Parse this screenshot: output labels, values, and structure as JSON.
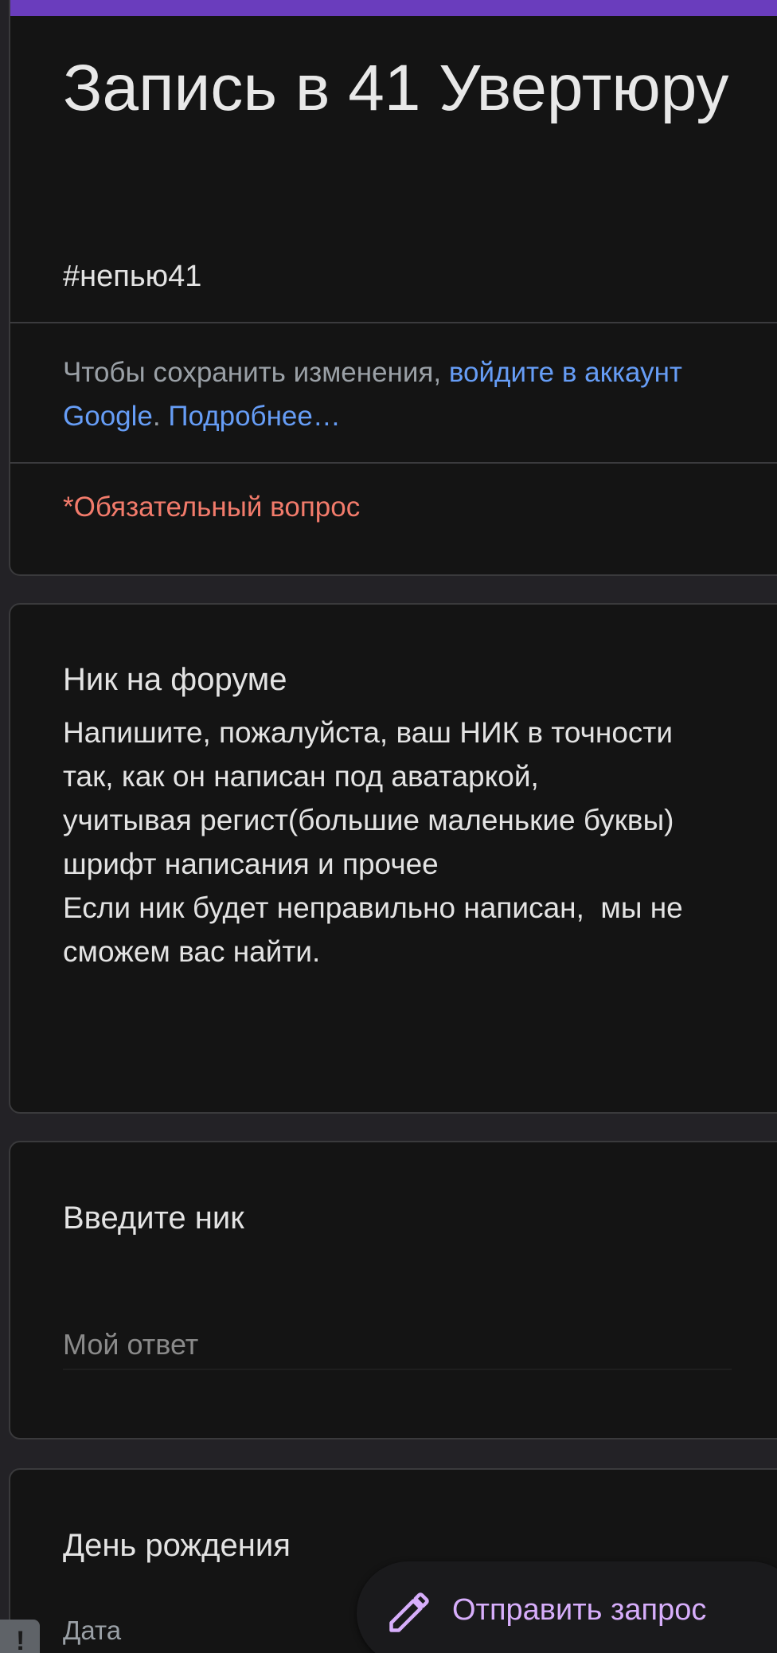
{
  "form": {
    "title": "Запись в 41 Увертюру",
    "description": "#непью41",
    "accent_color": "#6a3dbd"
  },
  "signin_note": {
    "text_before": "Чтобы сохранить изменения, ",
    "signin_link": "войдите в аккаунт Google",
    "separator": ". ",
    "learn_more_link": "Подробнее…"
  },
  "required_note": "*Обязательный вопрос",
  "nick_section": {
    "title": "Ник на форуме",
    "help_lines": [
      "Напишите, пожалуйста, ваш НИК в точности так, как он написан под аватаркой,",
      "учитывая регист(большие маленькие буквы)",
      "шрифт написания и прочее",
      "Если ник будет неправильно написан,  мы не сможем вас найти."
    ]
  },
  "nick_question": {
    "title": "Введите ник",
    "placeholder": "Мой ответ",
    "value": ""
  },
  "birthday_question": {
    "title": "День рождения",
    "date_label": "Дата"
  },
  "fab": {
    "icon": "pencil-icon",
    "label": "Отправить запрос",
    "color": "#d7aefb"
  },
  "report_badge": {
    "icon": "exclamation-icon",
    "glyph": "!"
  }
}
